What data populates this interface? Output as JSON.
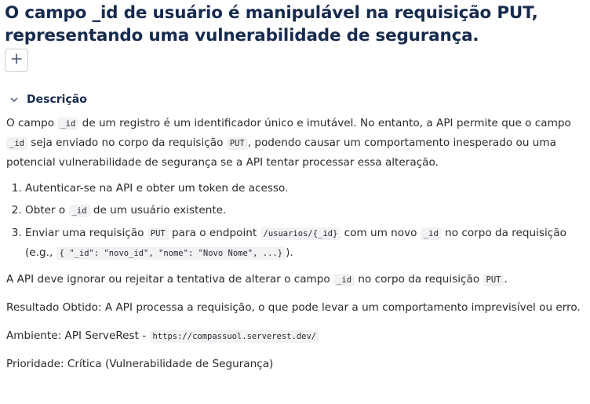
{
  "issue": {
    "title": "O campo _id de usuário é manipulável na requisição PUT, representando uma vulnerabilidade de segurança."
  },
  "toolbar": {
    "add_icon": "plus-icon"
  },
  "section": {
    "toggle_icon": "chevron-down-icon",
    "title": "Descrição"
  },
  "description": {
    "intro": {
      "t1": "O campo ",
      "c1": "_id",
      "t2": " de um registro é um identificador único e imutável. No entanto, a API permite que o campo ",
      "c2": "_id",
      "t3": " seja enviado no corpo da requisição ",
      "c3": "PUT",
      "t4": ", podendo causar um comportamento inesperado ou uma potencial vulnerabilidade de segurança se a API tentar processar essa alteração."
    },
    "steps": [
      {
        "text": "Autenticar-se na API e obter um token de acesso."
      },
      {
        "t1": "Obter o ",
        "c1": "_id",
        "t2": " de um usuário existente."
      },
      {
        "t1": "Enviar uma requisição ",
        "c1": "PUT",
        "t2": " para o endpoint ",
        "c2": "/usuarios/{_id}",
        "t3": " com um novo ",
        "c3": "_id",
        "t4": " no corpo da requisição (e.g., ",
        "c4": "{ \"_id\": \"novo_id\", \"nome\": \"Novo Nome\", ...}",
        "t5": ")."
      }
    ],
    "expected": {
      "t1": " A API deve ignorar ou rejeitar a tentativa de alterar o campo ",
      "c1": "_id",
      "t2": " no corpo da requisição ",
      "c2": "PUT",
      "t3": "."
    },
    "result": "Resultado Obtido: A API processa a requisição, o que pode levar a um comportamento imprevisível ou erro.",
    "environment": {
      "label": "Ambiente: API ServeRest - ",
      "url": "https://compassuol.serverest.dev/"
    },
    "priority": "Prioridade: Crítica (Vulnerabilidade de Segurança)"
  },
  "colors": {
    "title": "#172b4d",
    "text": "#292a2e",
    "code_bg": "#f1f2f4",
    "border": "#c9cdd4"
  }
}
